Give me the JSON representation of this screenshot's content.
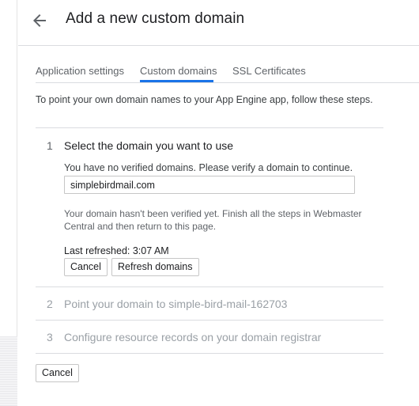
{
  "header": {
    "title": "Add a new custom domain",
    "back_icon": "arrow-left-icon"
  },
  "tabs": [
    {
      "label": "Application settings",
      "active": false
    },
    {
      "label": "Custom domains",
      "active": true
    },
    {
      "label": "SSL Certificates",
      "active": false
    }
  ],
  "intro": "To point your own domain names to your App Engine app, follow these steps.",
  "steps": [
    {
      "number": "1",
      "title": "Select the domain you want to use",
      "description": "You have no verified domains. Please verify a domain to continue.",
      "domain_value": "simplebirdmail.com",
      "note": "Your domain hasn't been verified yet. Finish all the steps in Webmaster Central and then return to this page.",
      "last_refreshed": "Last refreshed: 3:07 AM",
      "cancel_label": "Cancel",
      "refresh_label": "Refresh domains"
    },
    {
      "number": "2",
      "title": "Point your domain to simple-bird-mail-162703"
    },
    {
      "number": "3",
      "title": "Configure resource records on your domain registrar"
    }
  ],
  "footer": {
    "cancel_label": "Cancel"
  },
  "colors": {
    "accent": "#1a73e8",
    "muted_text": "#9aa0a6"
  }
}
